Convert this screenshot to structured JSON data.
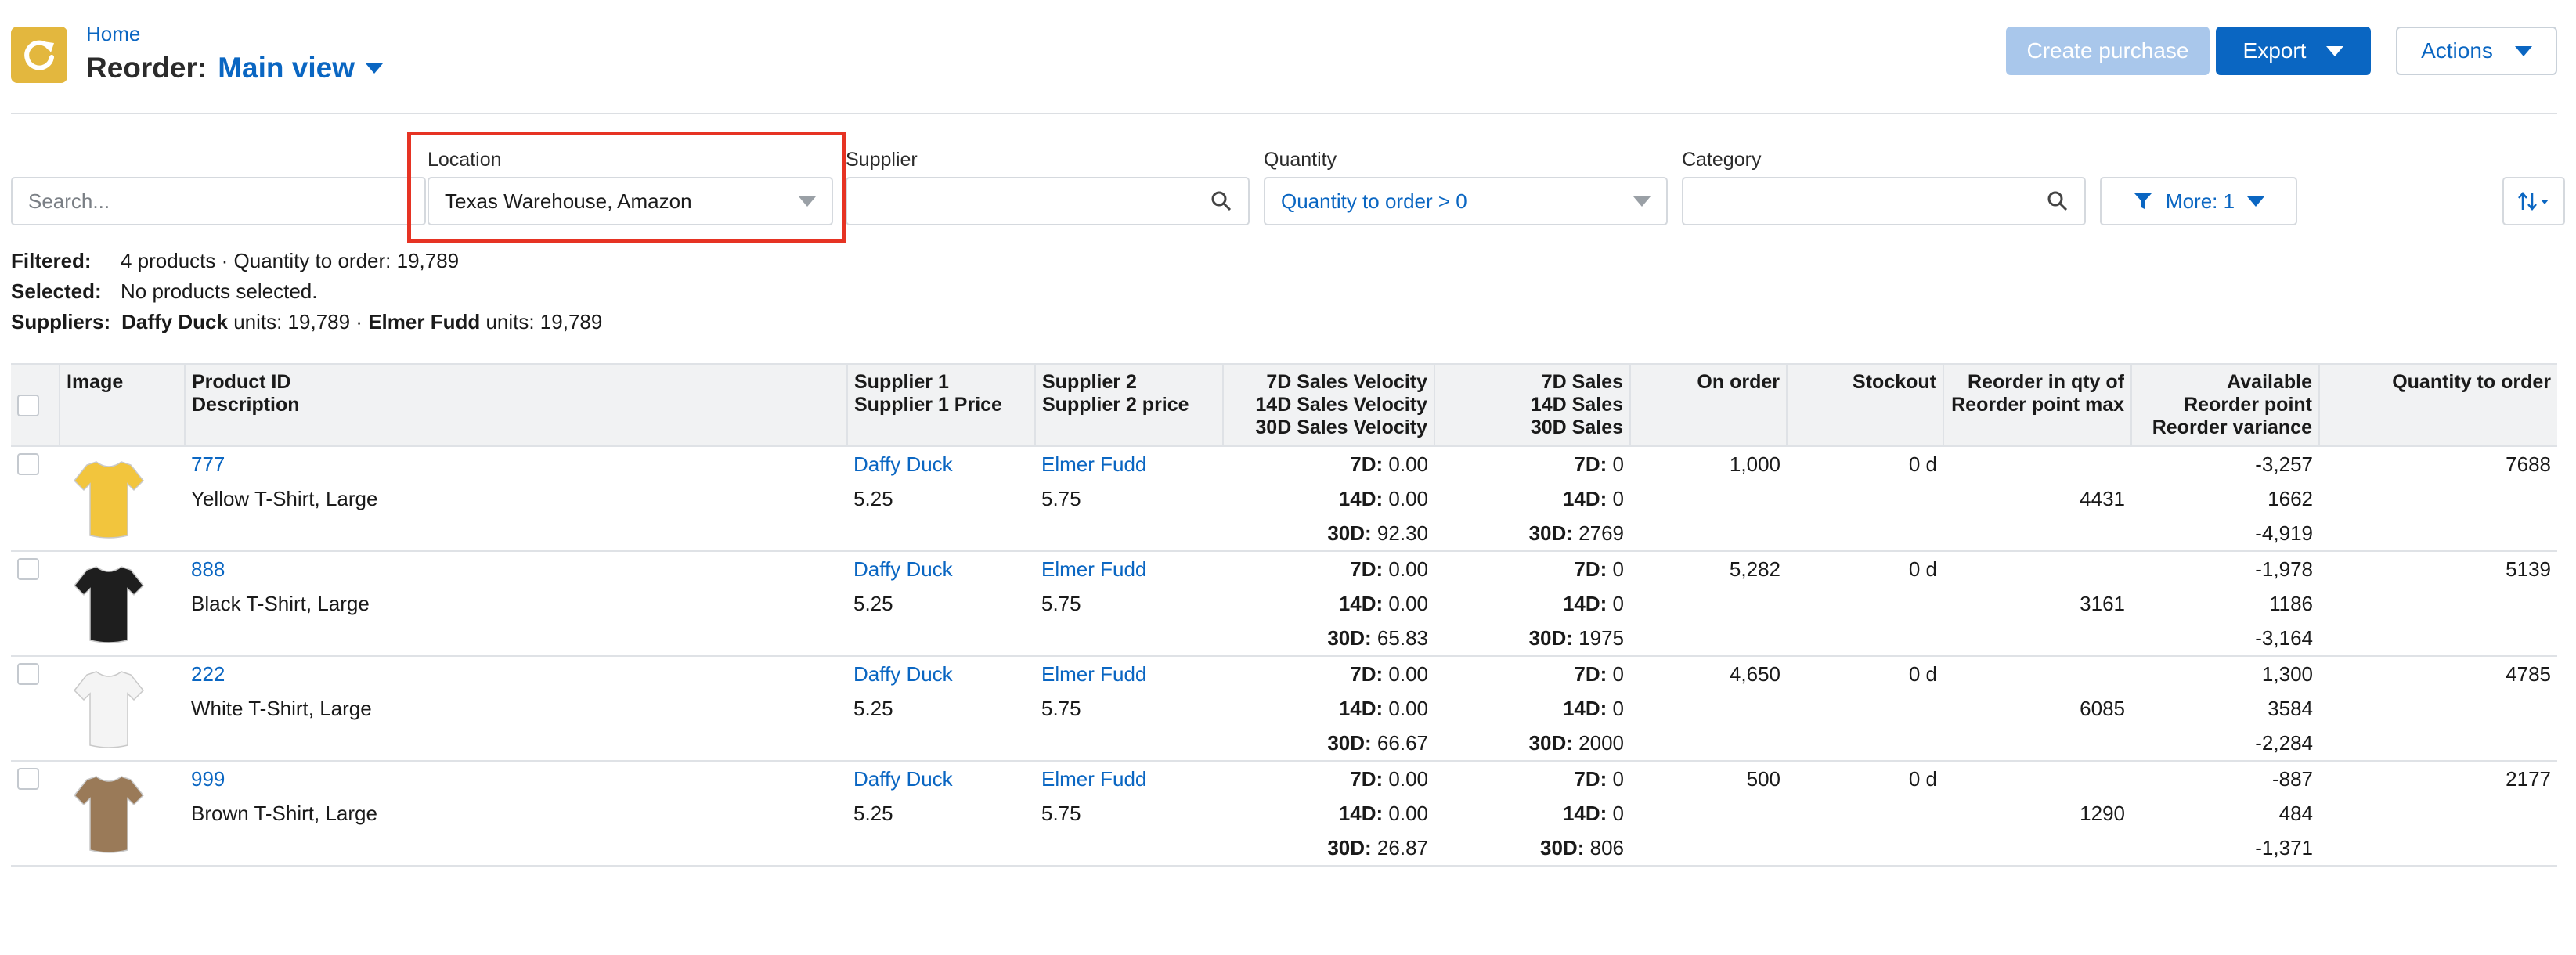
{
  "header": {
    "breadcrumb": "Home",
    "title": "Reorder:",
    "view_name": "Main view",
    "create_purchase_label": "Create purchase",
    "export_label": "Export",
    "actions_label": "Actions"
  },
  "filters": {
    "search_placeholder": "Search...",
    "location_label": "Location",
    "location_value": "Texas Warehouse,  Amazon",
    "supplier_label": "Supplier",
    "supplier_value": "",
    "quantity_label": "Quantity",
    "quantity_value": "Quantity to order > 0",
    "category_label": "Category",
    "category_value": "",
    "more_label": "More: 1"
  },
  "summary": {
    "filtered_label": "Filtered:",
    "filtered_value": "4 products · Quantity to order: 19,789",
    "selected_label": "Selected:",
    "selected_value": "No products selected.",
    "suppliers_label": "Suppliers:",
    "supplier1_name": "Daffy Duck",
    "supplier1_units": " units: 19,789 · ",
    "supplier2_name": "Elmer Fudd",
    "supplier2_units": " units: 19,789"
  },
  "table": {
    "headers": {
      "image": "Image",
      "product_id": "Product ID",
      "description": "Description",
      "supplier1": "Supplier 1",
      "supplier1_price": "Supplier 1 Price",
      "supplier2": "Supplier 2",
      "supplier2_price": "Supplier 2 price",
      "vel7": "7D Sales Velocity",
      "vel14": "14D Sales Velocity",
      "vel30": "30D Sales Velocity",
      "sales7": "7D Sales",
      "sales14": "14D Sales",
      "sales30": "30D Sales",
      "on_order": "On order",
      "stockout": "Stockout",
      "reorder_in_qty": "Reorder in qty of",
      "reorder_point_max": "Reorder point max",
      "available": "Available",
      "reorder_point": "Reorder point",
      "reorder_variance": "Reorder variance",
      "qty_to_order": "Quantity to order"
    },
    "label_7d": "7D:",
    "label_14d": "14D:",
    "label_30d": "30D:",
    "rows": [
      {
        "id": "777",
        "desc": "Yellow T-Shirt, Large",
        "image": "yellow-tshirt",
        "color": "#f2c53d",
        "s1": "Daffy Duck",
        "s1p": "5.25",
        "s2": "Elmer Fudd",
        "s2p": "5.75",
        "v7": "0.00",
        "v14": "0.00",
        "v30": "92.30",
        "sl7": "0",
        "sl14": "0",
        "sl30": "2769",
        "on_order": "1,000",
        "stockout": "0 d",
        "rpm": "4431",
        "avail": "-3,257",
        "rp": "1662",
        "rv": "-4,919",
        "qty": "7688"
      },
      {
        "id": "888",
        "desc": "Black T-Shirt, Large",
        "image": "black-tshirt",
        "color": "#1e1e1e",
        "s1": "Daffy Duck",
        "s1p": "5.25",
        "s2": "Elmer Fudd",
        "s2p": "5.75",
        "v7": "0.00",
        "v14": "0.00",
        "v30": "65.83",
        "sl7": "0",
        "sl14": "0",
        "sl30": "1975",
        "on_order": "5,282",
        "stockout": "0 d",
        "rpm": "3161",
        "avail": "-1,978",
        "rp": "1186",
        "rv": "-3,164",
        "qty": "5139"
      },
      {
        "id": "222",
        "desc": "White T-Shirt, Large",
        "image": "white-tshirt",
        "color": "#f4f4f4",
        "s1": "Daffy Duck",
        "s1p": "5.25",
        "s2": "Elmer Fudd",
        "s2p": "5.75",
        "v7": "0.00",
        "v14": "0.00",
        "v30": "66.67",
        "sl7": "0",
        "sl14": "0",
        "sl30": "2000",
        "on_order": "4,650",
        "stockout": "0 d",
        "rpm": "6085",
        "avail": "1,300",
        "rp": "3584",
        "rv": "-2,284",
        "qty": "4785"
      },
      {
        "id": "999",
        "desc": "Brown T-Shirt, Large",
        "image": "brown-tshirt",
        "color": "#9a7a58",
        "s1": "Daffy Duck",
        "s1p": "5.25",
        "s2": "Elmer Fudd",
        "s2p": "5.75",
        "v7": "0.00",
        "v14": "0.00",
        "v30": "26.87",
        "sl7": "0",
        "sl14": "0",
        "sl30": "806",
        "on_order": "500",
        "stockout": "0 d",
        "rpm": "1290",
        "avail": "-887",
        "rp": "484",
        "rv": "-1,371",
        "qty": "2177"
      }
    ]
  },
  "colors": {
    "accent": "#0a66c2",
    "logo": "#e3b73e",
    "highlight": "#e63323",
    "disabled_button": "#a9c7eb"
  }
}
